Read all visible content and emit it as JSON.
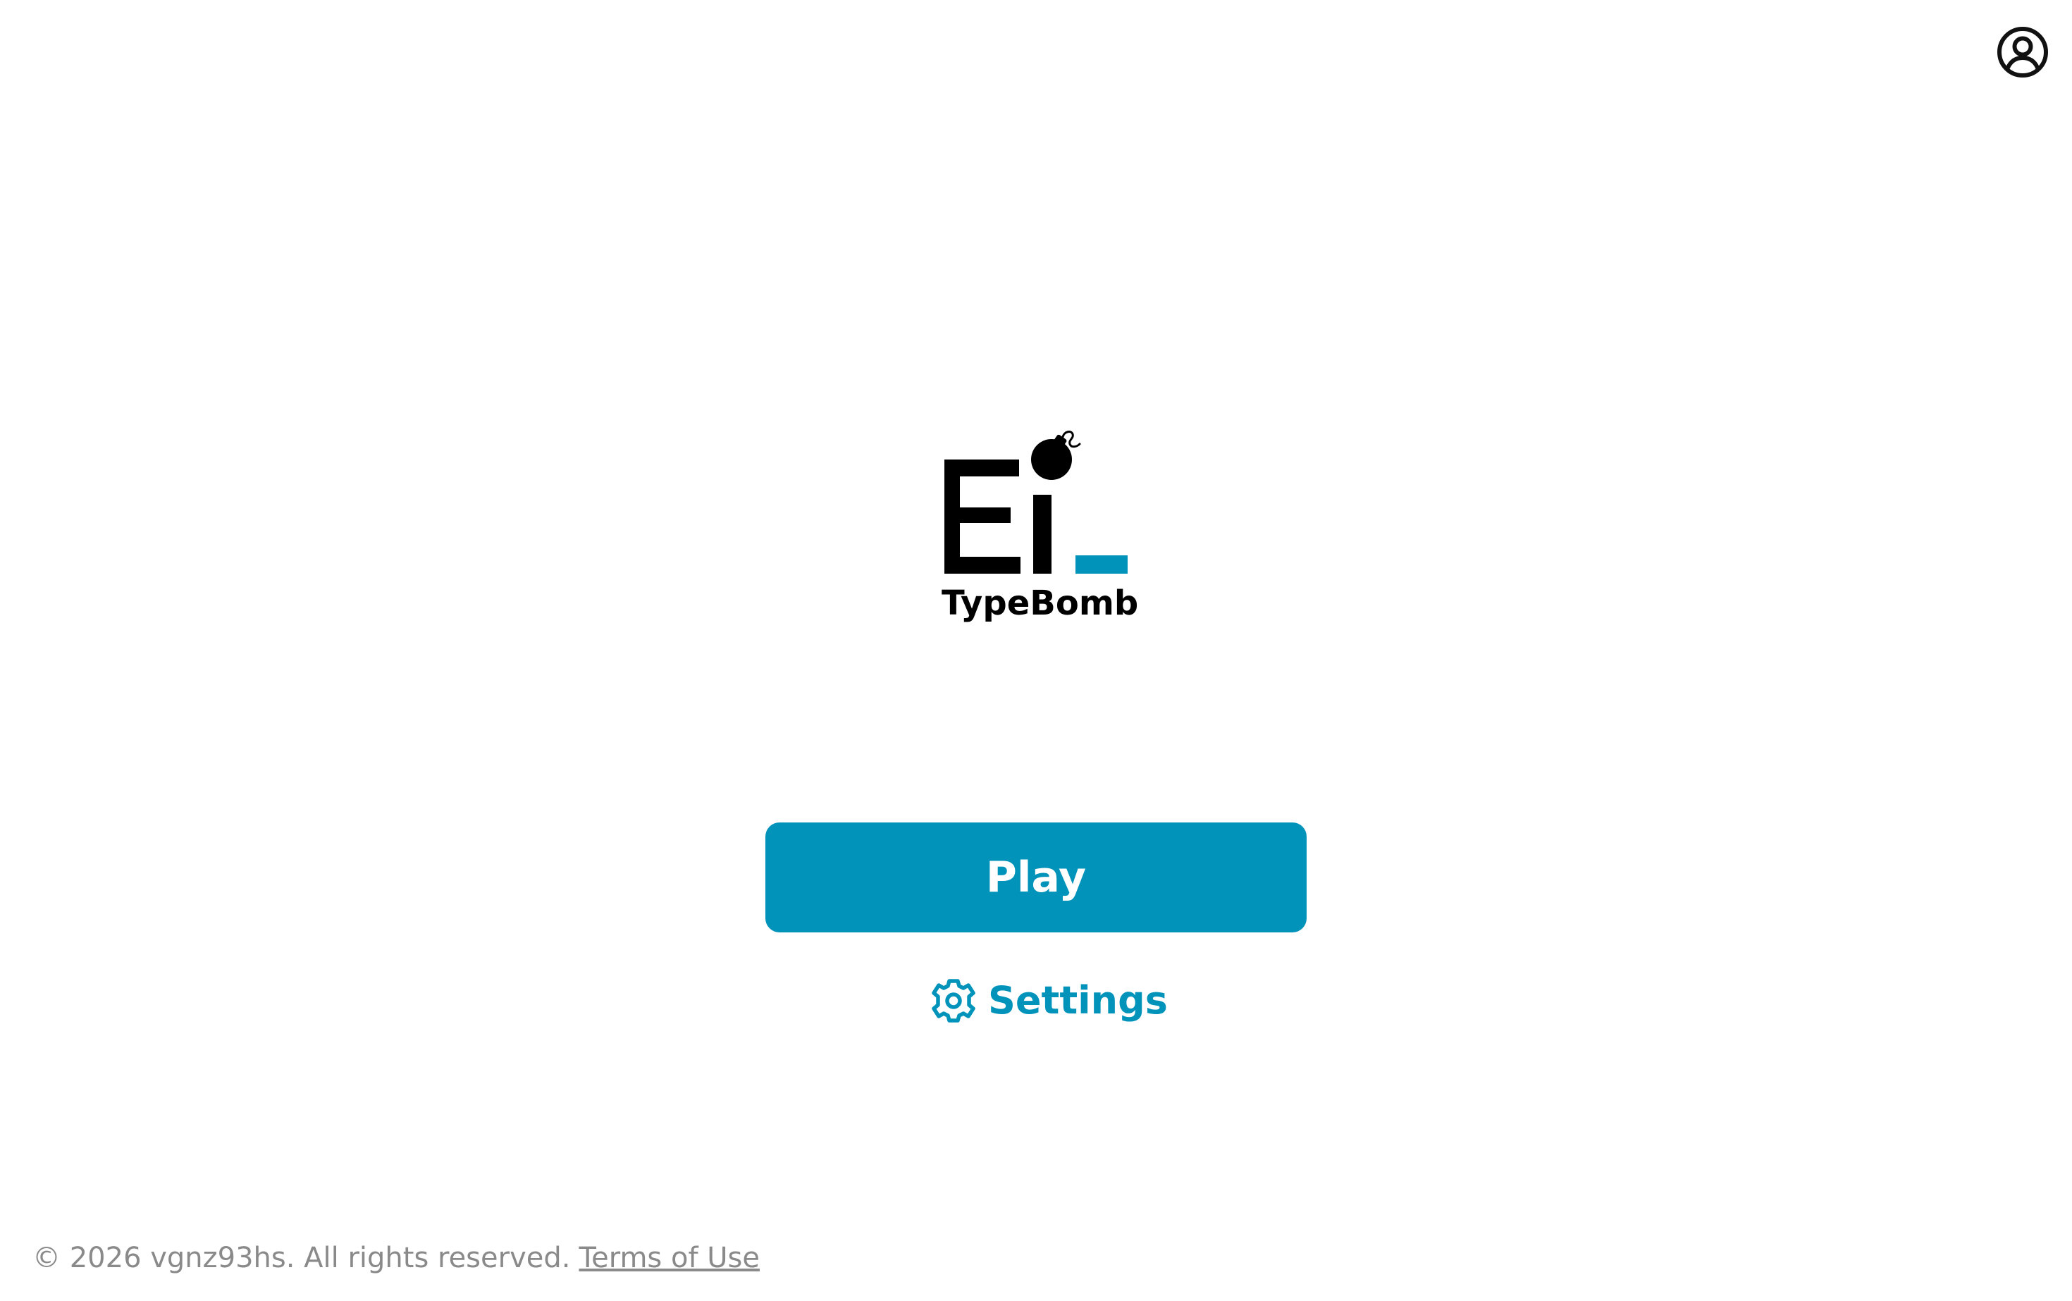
{
  "colors": {
    "accent": "#0293BB",
    "text": "#000000",
    "muted": "#8A8A8A",
    "background": "#FFFFFF"
  },
  "header": {
    "account_icon": "user-circle-icon"
  },
  "logo": {
    "mark_text": "Ei",
    "wordmark": "TypeBomb",
    "bomb_icon": "bomb-icon"
  },
  "actions": {
    "play_label": "Play",
    "settings_label": "Settings",
    "settings_icon": "gear-icon"
  },
  "footer": {
    "copyright": "© 2026 vgnz93hs. All rights reserved.",
    "terms_label": "Terms of Use"
  }
}
